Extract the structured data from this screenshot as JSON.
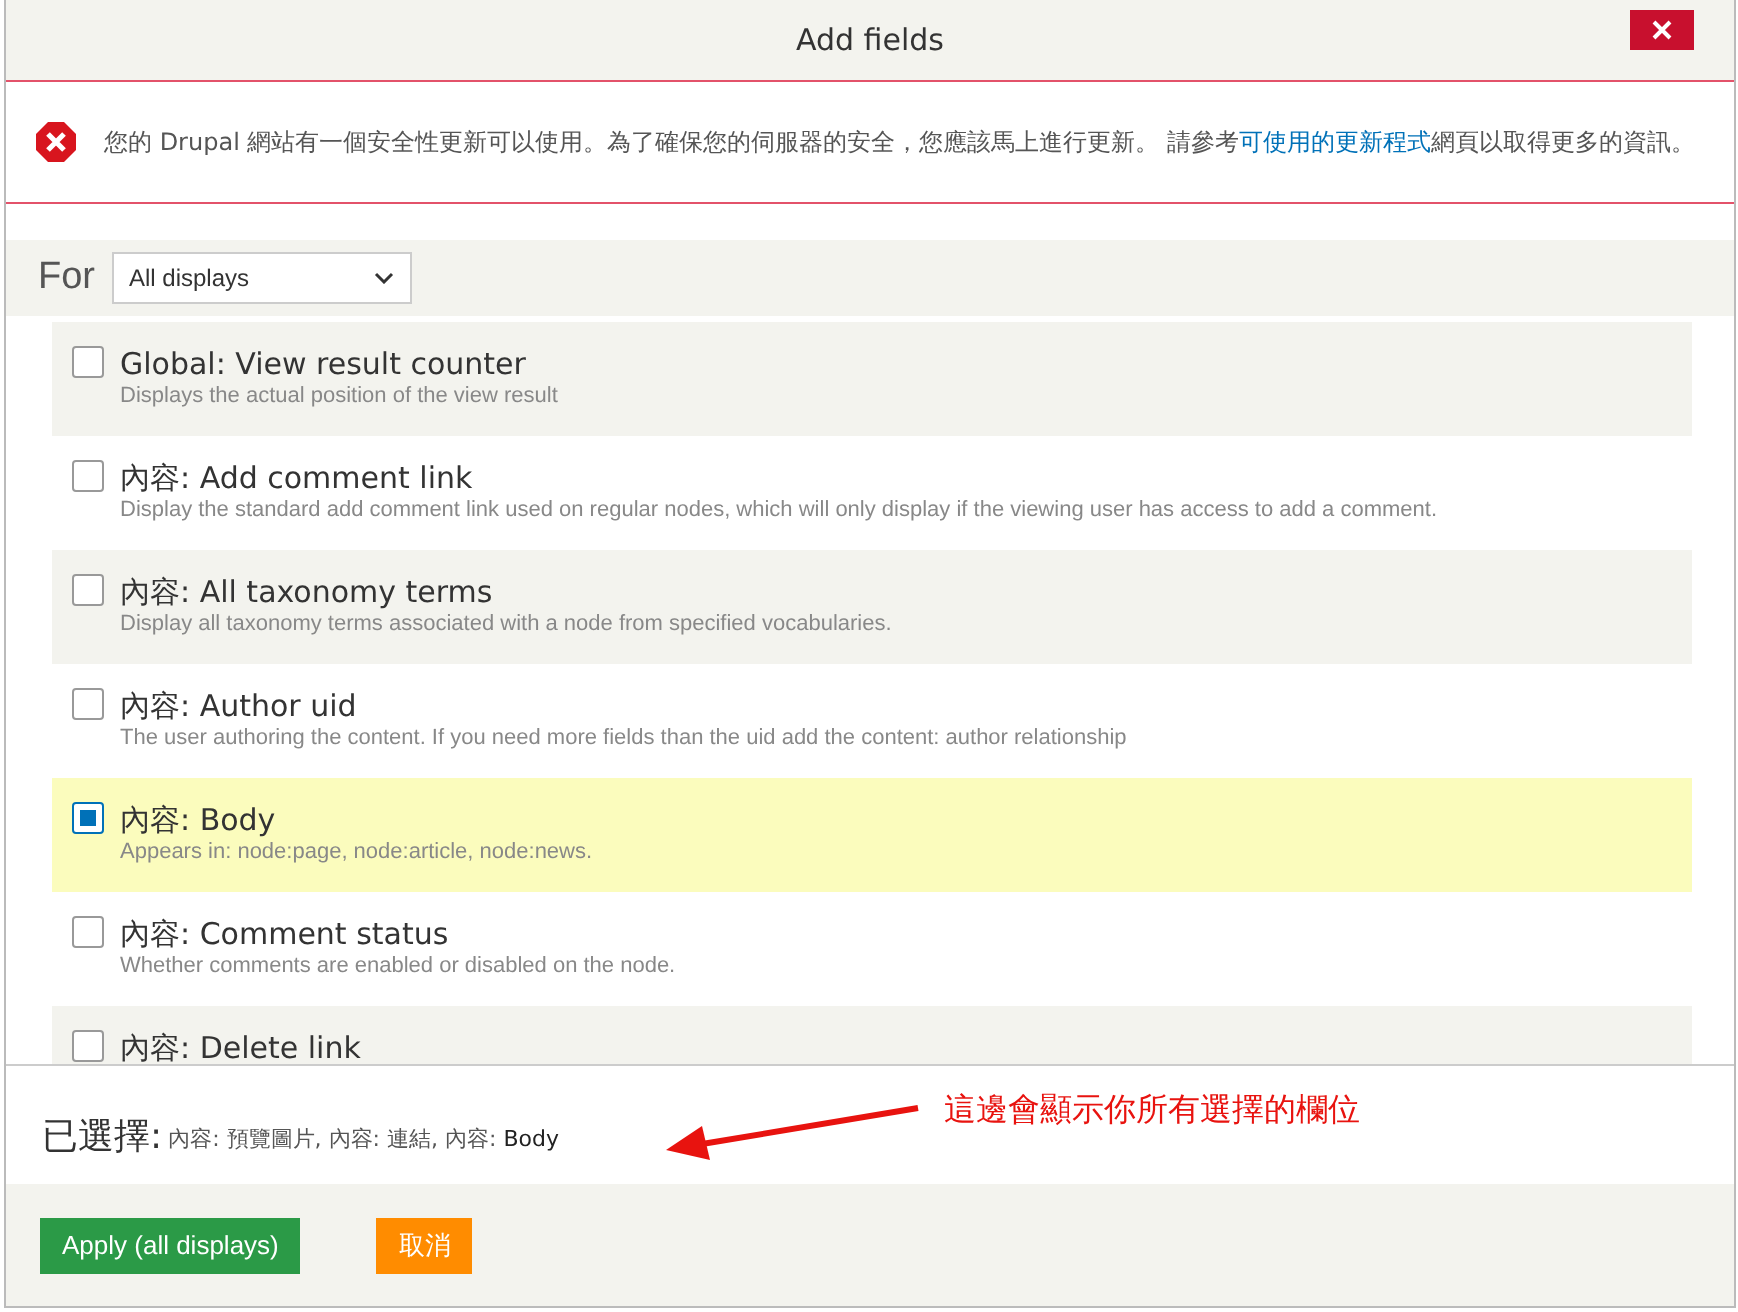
{
  "window": {
    "title": "Add fields"
  },
  "alert": {
    "text_before": "您的 Drupal 網站有一個安全性更新可以使用。為了確保您的伺服器的安全，您應該馬上進行更新。 請參考",
    "link": "可使用的更新程式",
    "text_after": "網頁以取得更多的資訊。"
  },
  "filter": {
    "label": "For",
    "value": "All displays"
  },
  "fields": [
    {
      "title": "Global: View result counter",
      "description": "Displays the actual position of the view result",
      "checked": false
    },
    {
      "title": "內容: Add comment link",
      "description": "Display the standard add comment link used on regular nodes, which will only display if the viewing user has access to add a comment.",
      "checked": false
    },
    {
      "title": "內容: All taxonomy terms",
      "description": "Display all taxonomy terms associated with a node from specified vocabularies.",
      "checked": false
    },
    {
      "title": "內容: Author uid",
      "description": "The user authoring the content. If you need more fields than the uid add the content: author relationship",
      "checked": false
    },
    {
      "title": "內容: Body",
      "description": "Appears in: node:page, node:article, node:news.",
      "checked": true
    },
    {
      "title": "內容: Comment status",
      "description": "Whether comments are enabled or disabled on the node.",
      "checked": false
    },
    {
      "title": "內容: Delete link",
      "checked": false
    }
  ],
  "selected_summary": {
    "label": "已選擇:",
    "value": "內容: 預覽圖片, 內容: 連結, 內容: **Body**"
  },
  "annotation": "這邊會顯示你所有選擇的欄位",
  "buttons": [
    {
      "label": "Apply (all displays)",
      "kind": "primary"
    },
    {
      "label": "取消",
      "kind": "cancel"
    }
  ]
}
